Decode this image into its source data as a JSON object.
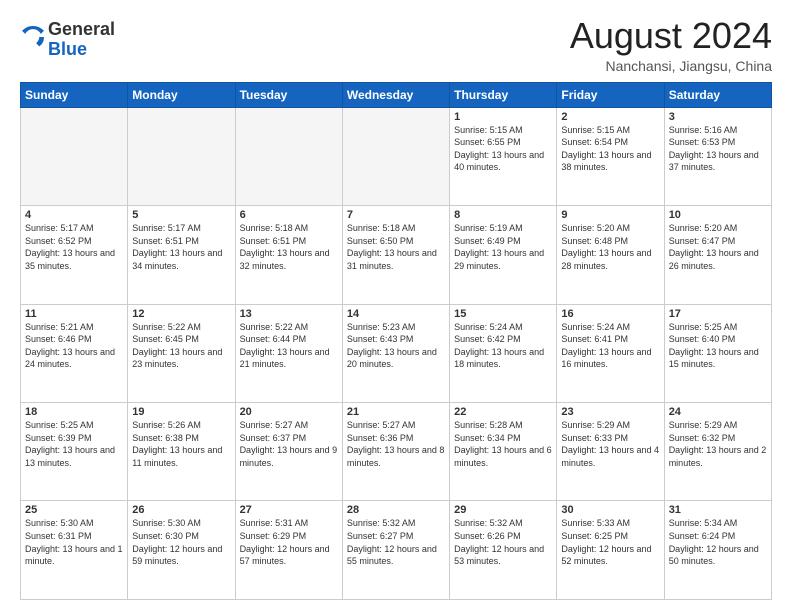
{
  "header": {
    "logo_general": "General",
    "logo_blue": "Blue",
    "month_year": "August 2024",
    "location": "Nanchansi, Jiangsu, China"
  },
  "weekdays": [
    "Sunday",
    "Monday",
    "Tuesday",
    "Wednesday",
    "Thursday",
    "Friday",
    "Saturday"
  ],
  "weeks": [
    [
      {
        "day": "",
        "empty": true
      },
      {
        "day": "",
        "empty": true
      },
      {
        "day": "",
        "empty": true
      },
      {
        "day": "",
        "empty": true
      },
      {
        "day": "1",
        "rise": "5:15 AM",
        "set": "6:55 PM",
        "daylight": "13 hours and 40 minutes."
      },
      {
        "day": "2",
        "rise": "5:15 AM",
        "set": "6:54 PM",
        "daylight": "13 hours and 38 minutes."
      },
      {
        "day": "3",
        "rise": "5:16 AM",
        "set": "6:53 PM",
        "daylight": "13 hours and 37 minutes."
      }
    ],
    [
      {
        "day": "4",
        "rise": "5:17 AM",
        "set": "6:52 PM",
        "daylight": "13 hours and 35 minutes."
      },
      {
        "day": "5",
        "rise": "5:17 AM",
        "set": "6:51 PM",
        "daylight": "13 hours and 34 minutes."
      },
      {
        "day": "6",
        "rise": "5:18 AM",
        "set": "6:51 PM",
        "daylight": "13 hours and 32 minutes."
      },
      {
        "day": "7",
        "rise": "5:18 AM",
        "set": "6:50 PM",
        "daylight": "13 hours and 31 minutes."
      },
      {
        "day": "8",
        "rise": "5:19 AM",
        "set": "6:49 PM",
        "daylight": "13 hours and 29 minutes."
      },
      {
        "day": "9",
        "rise": "5:20 AM",
        "set": "6:48 PM",
        "daylight": "13 hours and 28 minutes."
      },
      {
        "day": "10",
        "rise": "5:20 AM",
        "set": "6:47 PM",
        "daylight": "13 hours and 26 minutes."
      }
    ],
    [
      {
        "day": "11",
        "rise": "5:21 AM",
        "set": "6:46 PM",
        "daylight": "13 hours and 24 minutes."
      },
      {
        "day": "12",
        "rise": "5:22 AM",
        "set": "6:45 PM",
        "daylight": "13 hours and 23 minutes."
      },
      {
        "day": "13",
        "rise": "5:22 AM",
        "set": "6:44 PM",
        "daylight": "13 hours and 21 minutes."
      },
      {
        "day": "14",
        "rise": "5:23 AM",
        "set": "6:43 PM",
        "daylight": "13 hours and 20 minutes."
      },
      {
        "day": "15",
        "rise": "5:24 AM",
        "set": "6:42 PM",
        "daylight": "13 hours and 18 minutes."
      },
      {
        "day": "16",
        "rise": "5:24 AM",
        "set": "6:41 PM",
        "daylight": "13 hours and 16 minutes."
      },
      {
        "day": "17",
        "rise": "5:25 AM",
        "set": "6:40 PM",
        "daylight": "13 hours and 15 minutes."
      }
    ],
    [
      {
        "day": "18",
        "rise": "5:25 AM",
        "set": "6:39 PM",
        "daylight": "13 hours and 13 minutes."
      },
      {
        "day": "19",
        "rise": "5:26 AM",
        "set": "6:38 PM",
        "daylight": "13 hours and 11 minutes."
      },
      {
        "day": "20",
        "rise": "5:27 AM",
        "set": "6:37 PM",
        "daylight": "13 hours and 9 minutes."
      },
      {
        "day": "21",
        "rise": "5:27 AM",
        "set": "6:36 PM",
        "daylight": "13 hours and 8 minutes."
      },
      {
        "day": "22",
        "rise": "5:28 AM",
        "set": "6:34 PM",
        "daylight": "13 hours and 6 minutes."
      },
      {
        "day": "23",
        "rise": "5:29 AM",
        "set": "6:33 PM",
        "daylight": "13 hours and 4 minutes."
      },
      {
        "day": "24",
        "rise": "5:29 AM",
        "set": "6:32 PM",
        "daylight": "13 hours and 2 minutes."
      }
    ],
    [
      {
        "day": "25",
        "rise": "5:30 AM",
        "set": "6:31 PM",
        "daylight": "13 hours and 1 minute."
      },
      {
        "day": "26",
        "rise": "5:30 AM",
        "set": "6:30 PM",
        "daylight": "12 hours and 59 minutes."
      },
      {
        "day": "27",
        "rise": "5:31 AM",
        "set": "6:29 PM",
        "daylight": "12 hours and 57 minutes."
      },
      {
        "day": "28",
        "rise": "5:32 AM",
        "set": "6:27 PM",
        "daylight": "12 hours and 55 minutes."
      },
      {
        "day": "29",
        "rise": "5:32 AM",
        "set": "6:26 PM",
        "daylight": "12 hours and 53 minutes."
      },
      {
        "day": "30",
        "rise": "5:33 AM",
        "set": "6:25 PM",
        "daylight": "12 hours and 52 minutes."
      },
      {
        "day": "31",
        "rise": "5:34 AM",
        "set": "6:24 PM",
        "daylight": "12 hours and 50 minutes."
      }
    ]
  ]
}
